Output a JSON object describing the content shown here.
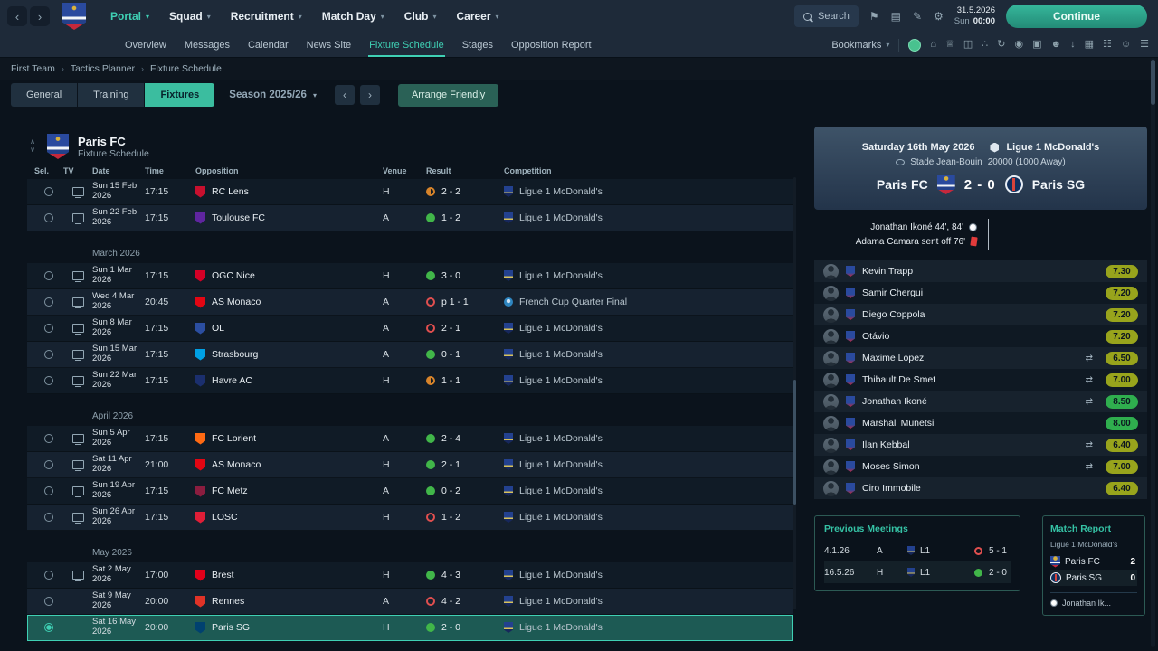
{
  "colors": {
    "accent": "#3fd0b4",
    "win": "#41b649",
    "draw": "#d8842a",
    "loss": "#e04f4f",
    "rating_good": "#98a41c",
    "rating_great": "#2fae4e"
  },
  "topbar": {
    "club": "Paris FC",
    "menus": [
      {
        "label": "Portal",
        "active": true
      },
      {
        "label": "Squad"
      },
      {
        "label": "Recruitment"
      },
      {
        "label": "Match Day"
      },
      {
        "label": "Club"
      },
      {
        "label": "Career"
      }
    ],
    "search_placeholder": "Search",
    "icons": [
      {
        "name": "bookmark-icon",
        "glyph": "⚑"
      },
      {
        "name": "notes-icon",
        "glyph": "▤"
      },
      {
        "name": "edit-icon",
        "glyph": "✎"
      },
      {
        "name": "settings-icon",
        "glyph": "⚙"
      }
    ],
    "date": "31.5.2026",
    "day": "Sun",
    "time": "00:00",
    "continue_label": "Continue"
  },
  "subnav": {
    "items": [
      {
        "label": "Overview"
      },
      {
        "label": "Messages"
      },
      {
        "label": "Calendar"
      },
      {
        "label": "News Site"
      },
      {
        "label": "Fixture Schedule",
        "active": true
      },
      {
        "label": "Stages"
      },
      {
        "label": "Opposition Report"
      }
    ],
    "bookmarks_label": "Bookmarks",
    "icons": [
      {
        "name": "manager-avatar-icon",
        "glyph": ""
      },
      {
        "name": "home-icon",
        "glyph": "⌂"
      },
      {
        "name": "trophy-icon",
        "glyph": "♕"
      },
      {
        "name": "shirt-icon",
        "glyph": "◫"
      },
      {
        "name": "tactics-icon",
        "glyph": "∴"
      },
      {
        "name": "refresh-icon",
        "glyph": "↻"
      },
      {
        "name": "medal-icon",
        "glyph": "◉"
      },
      {
        "name": "kit-icon",
        "glyph": "▣"
      },
      {
        "name": "squad-icon",
        "glyph": "☻"
      },
      {
        "name": "download-icon",
        "glyph": "↓"
      },
      {
        "name": "calendar-icon",
        "glyph": "▦"
      },
      {
        "name": "league-table-icon",
        "glyph": "☷"
      },
      {
        "name": "staff-icon",
        "glyph": "☺"
      },
      {
        "name": "menu-icon",
        "glyph": "☰"
      }
    ]
  },
  "breadcrumb": {
    "items": [
      "First Team",
      "Tactics Planner",
      "Fixture Schedule"
    ]
  },
  "toolbar": {
    "tabs": [
      {
        "label": "General"
      },
      {
        "label": "Training"
      },
      {
        "label": "Fixtures",
        "active": true
      }
    ],
    "season_label": "Season 2025/26",
    "arrange_friendly_label": "Arrange Friendly"
  },
  "fixture_panel": {
    "team": "Paris FC",
    "subtitle": "Fixture Schedule",
    "columns": [
      "Sel.",
      "TV",
      "Date",
      "Time",
      "Opposition",
      "Venue",
      "Result",
      "Competition"
    ],
    "groups": [
      {
        "header": "",
        "rows": [
          {
            "tv": true,
            "date": "Sun 15 Feb 2026",
            "time": "17:15",
            "opposition": "RC Lens",
            "crest": "#c8102e",
            "venue": "H",
            "result": "2 - 2",
            "outcome": "draw",
            "competition": "Ligue 1 McDonald's",
            "comp_type": "league"
          },
          {
            "tv": true,
            "date": "Sun 22 Feb 2026",
            "time": "17:15",
            "opposition": "Toulouse FC",
            "crest": "#5f259f",
            "venue": "A",
            "result": "1 - 2",
            "outcome": "win",
            "competition": "Ligue 1 McDonald's",
            "comp_type": "league"
          }
        ]
      },
      {
        "header": "March 2026",
        "rows": [
          {
            "tv": true,
            "date": "Sun 1 Mar 2026",
            "time": "17:15",
            "opposition": "OGC Nice",
            "crest": "#d40026",
            "venue": "H",
            "result": "3 - 0",
            "outcome": "win",
            "competition": "Ligue 1 McDonald's",
            "comp_type": "league"
          },
          {
            "tv": true,
            "date": "Wed 4 Mar 2026",
            "time": "20:45",
            "opposition": "AS Monaco",
            "crest": "#e30613",
            "venue": "A",
            "result": "p 1 - 1",
            "outcome": "loss",
            "competition": "French Cup Quarter Final",
            "comp_type": "cup"
          },
          {
            "tv": true,
            "date": "Sun 8 Mar 2026",
            "time": "17:15",
            "opposition": "OL",
            "crest": "#2b4ea0",
            "venue": "A",
            "result": "2 - 1",
            "outcome": "loss",
            "competition": "Ligue 1 McDonald's",
            "comp_type": "league"
          },
          {
            "tv": true,
            "date": "Sun 15 Mar 2026",
            "time": "17:15",
            "opposition": "Strasbourg",
            "crest": "#00a0e4",
            "venue": "A",
            "result": "0 - 1",
            "outcome": "win",
            "competition": "Ligue 1 McDonald's",
            "comp_type": "league"
          },
          {
            "tv": true,
            "date": "Sun 22 Mar 2026",
            "time": "17:15",
            "opposition": "Havre AC",
            "crest": "#1b2f6e",
            "venue": "H",
            "result": "1 - 1",
            "outcome": "draw",
            "competition": "Ligue 1 McDonald's",
            "comp_type": "league"
          }
        ]
      },
      {
        "header": "April 2026",
        "rows": [
          {
            "tv": true,
            "date": "Sun 5 Apr 2026",
            "time": "17:15",
            "opposition": "FC Lorient",
            "crest": "#ff6a13",
            "venue": "A",
            "result": "2 - 4",
            "outcome": "win",
            "competition": "Ligue 1 McDonald's",
            "comp_type": "league"
          },
          {
            "tv": true,
            "date": "Sat 11 Apr 2026",
            "time": "21:00",
            "opposition": "AS Monaco",
            "crest": "#e30613",
            "venue": "H",
            "result": "2 - 1",
            "outcome": "win",
            "competition": "Ligue 1 McDonald's",
            "comp_type": "league"
          },
          {
            "tv": true,
            "date": "Sun 19 Apr 2026",
            "time": "17:15",
            "opposition": "FC Metz",
            "crest": "#8b1d3f",
            "venue": "A",
            "result": "0 - 2",
            "outcome": "win",
            "competition": "Ligue 1 McDonald's",
            "comp_type": "league"
          },
          {
            "tv": true,
            "date": "Sun 26 Apr 2026",
            "time": "17:15",
            "opposition": "LOSC",
            "crest": "#e01e37",
            "venue": "H",
            "result": "1 - 2",
            "outcome": "loss",
            "competition": "Ligue 1 McDonald's",
            "comp_type": "league"
          }
        ]
      },
      {
        "header": "May 2026",
        "rows": [
          {
            "tv": true,
            "date": "Sat 2 May 2026",
            "time": "17:00",
            "opposition": "Brest",
            "crest": "#e2001a",
            "venue": "H",
            "result": "4 - 3",
            "outcome": "win",
            "competition": "Ligue 1 McDonald's",
            "comp_type": "league"
          },
          {
            "tv": false,
            "date": "Sat 9 May 2026",
            "time": "20:00",
            "opposition": "Rennes",
            "crest": "#e13327",
            "venue": "A",
            "result": "4 - 2",
            "outcome": "loss",
            "competition": "Ligue 1 McDonald's",
            "comp_type": "league"
          },
          {
            "tv": false,
            "date": "Sat 16 May 2026",
            "time": "20:00",
            "opposition": "Paris SG",
            "crest": "#004170",
            "venue": "H",
            "result": "2 - 0",
            "outcome": "win",
            "competition": "Ligue 1 McDonald's",
            "comp_type": "league",
            "selected": true
          }
        ]
      }
    ]
  },
  "match": {
    "date_line": "Saturday 16th May 2026",
    "competition": "Ligue 1 McDonald's",
    "venue": "Stade Jean-Bouin",
    "attendance": "20000 (1000 Away)",
    "home_team": "Paris FC",
    "away_team": "Paris SG",
    "score": "2 - 0",
    "scorers": "Jonathan Ikoné 44', 84'",
    "sent_off": "Adama Camara sent off  76'",
    "ratings": [
      {
        "name": "Kevin Trapp",
        "rating": "7.30",
        "tier": "good"
      },
      {
        "name": "Samir Chergui",
        "rating": "7.20",
        "tier": "good"
      },
      {
        "name": "Diego Coppola",
        "rating": "7.20",
        "tier": "good"
      },
      {
        "name": "Otávio",
        "rating": "7.20",
        "tier": "good"
      },
      {
        "name": "Maxime Lopez",
        "rating": "6.50",
        "tier": "good",
        "sub": true
      },
      {
        "name": "Thibault De Smet",
        "rating": "7.00",
        "tier": "good",
        "sub": true
      },
      {
        "name": "Jonathan Ikoné",
        "rating": "8.50",
        "tier": "great",
        "sub": true
      },
      {
        "name": "Marshall Munetsi",
        "rating": "8.00",
        "tier": "great"
      },
      {
        "name": "Ilan Kebbal",
        "rating": "6.40",
        "tier": "good",
        "sub": true
      },
      {
        "name": "Moses Simon",
        "rating": "7.00",
        "tier": "good",
        "sub": true
      },
      {
        "name": "Ciro Immobile",
        "rating": "6.40",
        "tier": "good"
      }
    ]
  },
  "previous_meetings": {
    "title": "Previous Meetings",
    "rows": [
      {
        "date": "4.1.26",
        "venue": "A",
        "comp": "L1",
        "result": "5 - 1",
        "outcome": "loss"
      },
      {
        "date": "16.5.26",
        "venue": "H",
        "comp": "L1",
        "result": "2 - 0",
        "outcome": "win"
      }
    ]
  },
  "match_report": {
    "title": "Match Report",
    "competition": "Ligue 1 McDonald's",
    "teams": [
      {
        "name": "Paris FC",
        "score": "2"
      },
      {
        "name": "Paris SG",
        "score": "0"
      }
    ],
    "scorer_note": "Jonathan Ik..."
  }
}
